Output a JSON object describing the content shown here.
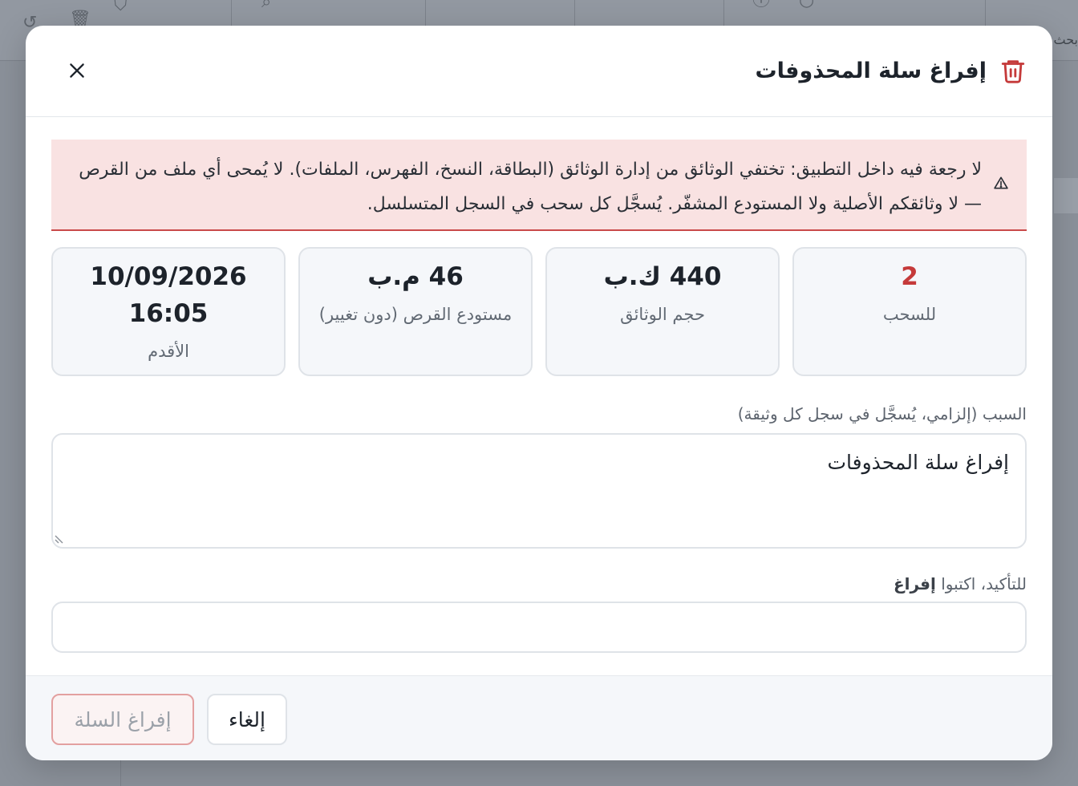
{
  "background": {
    "search_label": "بحث"
  },
  "dialog": {
    "title": "إفراغ سلة المحذوفات",
    "warning": "لا رجعة فيه داخل التطبيق: تختفي الوثائق من إدارة الوثائق (البطاقة، النسخ، الفهرس، الملفات). لا يُمحى أي ملف من القرص — لا وثائقكم الأصلية ولا المستودع المشفّر. يُسجَّل كل سحب في السجل المتسلسل.",
    "stats": [
      {
        "value": "2",
        "label": "للسحب",
        "tone": "danger"
      },
      {
        "value": "440 ك.ب",
        "label": "حجم الوثائق",
        "tone": "normal"
      },
      {
        "value": "46 م.ب",
        "label": "مستودع القرص (دون تغيير)",
        "tone": "normal"
      },
      {
        "value": "10/09/2026 16:05",
        "label": "الأقدم",
        "tone": "normal"
      }
    ],
    "reason_label": "السبب (إلزامي، يُسجَّل في سجل كل وثيقة)",
    "reason_value": "إفراغ سلة المحذوفات",
    "confirm_label_prefix": "للتأكيد، اكتبوا ",
    "confirm_keyword": "إفراغ",
    "confirm_value": "",
    "cancel_label": "إلغاء",
    "submit_label": "إفراغ السلة"
  },
  "colors": {
    "danger": "#c53a3a",
    "warning_bg": "#f9e2e2",
    "overlay": "#8b919a"
  },
  "icons": {
    "header": "trash-icon",
    "close": "close-icon",
    "warning": "warning-triangle-icon"
  }
}
